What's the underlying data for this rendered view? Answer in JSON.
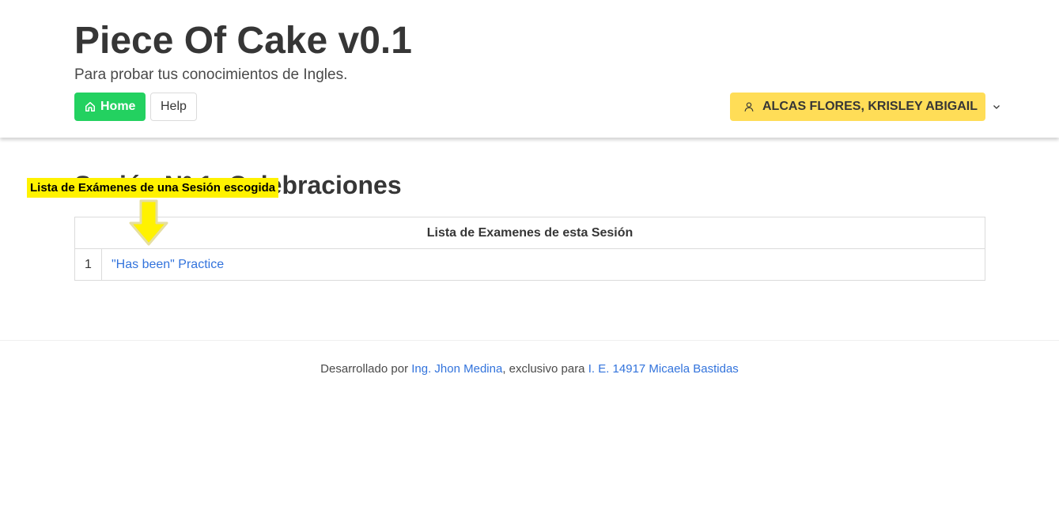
{
  "header": {
    "title": "Piece Of Cake v0.1",
    "subtitle": "Para probar tus conocimientos de Ingles.",
    "nav": {
      "home_label": "Home",
      "help_label": "Help"
    },
    "user": {
      "name": "ALCAS FLORES, KRISLEY ABIGAIL"
    }
  },
  "main": {
    "session_title": "Sesión Nº 1: Celebraciones",
    "table": {
      "header": "Lista de Examenes de esta Sesión",
      "rows": [
        {
          "num": "1",
          "exam": "\"Has been\" Practice"
        }
      ]
    }
  },
  "annotation": {
    "label": "Lista de Exámenes de una Sesión escogida",
    "color": "#fff200"
  },
  "footer": {
    "prefix": "Desarrollado por ",
    "author": "Ing. Jhon Medina",
    "middle": ", exclusivo para ",
    "school": "I. E. 14917 Micaela Bastidas"
  },
  "colors": {
    "primary": "#23d160",
    "warning": "#ffdd57",
    "link": "#3273dc"
  },
  "icons": {
    "home": "home-icon",
    "user": "user-icon",
    "chevron": "chevron-down-icon",
    "arrow": "arrow-down-icon"
  }
}
